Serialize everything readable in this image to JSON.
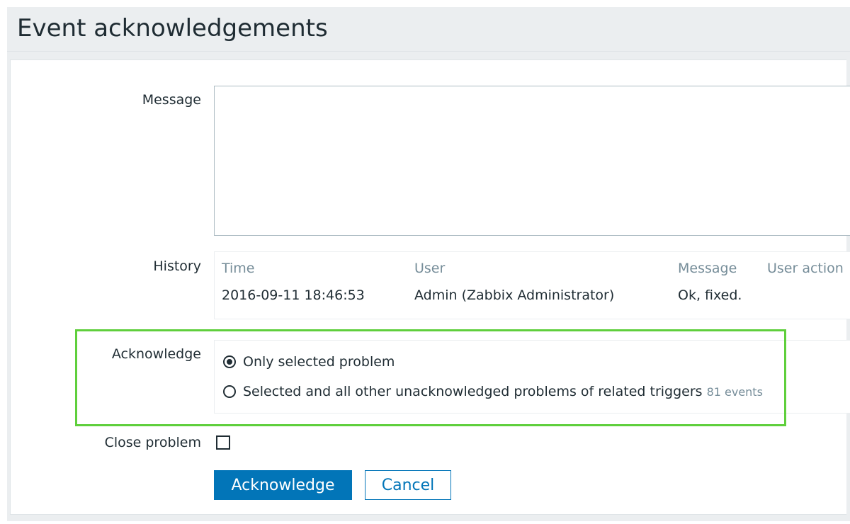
{
  "page": {
    "title": "Event acknowledgements"
  },
  "form": {
    "message_label": "Message",
    "message_value": "",
    "history_label": "History",
    "history": {
      "columns": [
        "Time",
        "User",
        "Message",
        "User action"
      ],
      "rows": [
        {
          "time": "2016-09-11 18:46:53",
          "user": "Admin (Zabbix Administrator)",
          "message": "Ok, fixed.",
          "user_action": ""
        }
      ]
    },
    "acknowledge_label": "Acknowledge",
    "acknowledge_options": [
      {
        "label": "Only selected problem",
        "checked": true
      },
      {
        "label": "Selected and all other unacknowledged problems of related triggers",
        "checked": false,
        "count": "81 events"
      }
    ],
    "close_problem_label": "Close problem",
    "close_problem_checked": false
  },
  "buttons": {
    "acknowledge": "Acknowledge",
    "cancel": "Cancel"
  },
  "colors": {
    "primary": "#0275b8",
    "highlight": "#5fcf3c",
    "background": "#ebeef0"
  }
}
